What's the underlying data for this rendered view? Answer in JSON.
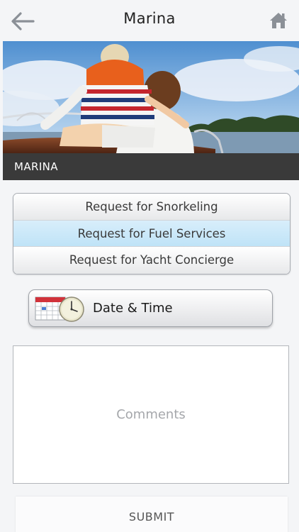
{
  "nav": {
    "title": "Marina",
    "back_icon": "back-arrow-icon",
    "home_icon": "home-icon"
  },
  "banner": {
    "label": "MARINA",
    "image": "two boys on a wooden boat facing the water"
  },
  "services": {
    "options": [
      {
        "label": "Request for Snorkeling",
        "selected": false
      },
      {
        "label": "Request for Fuel Services",
        "selected": true
      },
      {
        "label": "Request for Yacht Concierge",
        "selected": false
      }
    ]
  },
  "datetime": {
    "label": "Date & Time",
    "icon": "calendar-clock-icon"
  },
  "comments": {
    "placeholder": "Comments"
  },
  "submit": {
    "label": "SUBMIT"
  },
  "colors": {
    "selected_option": "#c6e6f8",
    "banner_label_bg": "#3a3a3a",
    "icon_gray": "#8b9097"
  }
}
